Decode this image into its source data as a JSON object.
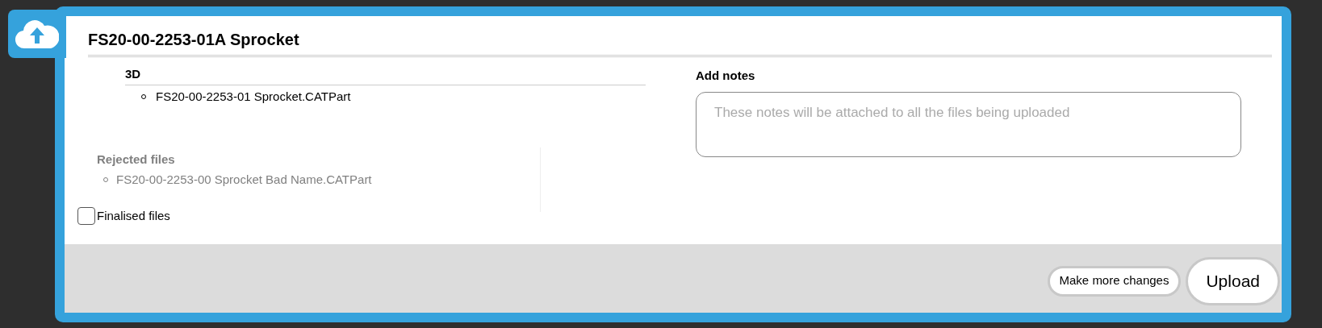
{
  "dialog": {
    "title": "FS20-00-2253-01A Sprocket"
  },
  "groups": [
    {
      "heading": "3D",
      "files": [
        "FS20-00-2253-01 Sprocket.CATPart"
      ]
    }
  ],
  "rejected": {
    "heading": "Rejected files",
    "files": [
      "FS20-00-2253-00 Sprocket Bad Name.CATPart"
    ]
  },
  "finalised": {
    "label": "Finalised files",
    "checked": false
  },
  "notes": {
    "label": "Add notes",
    "placeholder": "These notes will be attached to all the files being uploaded"
  },
  "buttons": [
    {
      "label": "Make more changes",
      "kind": "secondary"
    },
    {
      "label": "Upload",
      "kind": "primary"
    }
  ]
}
